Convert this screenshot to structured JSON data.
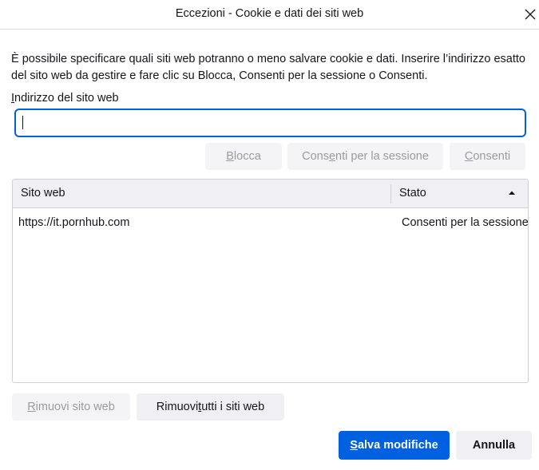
{
  "dialog": {
    "title": "Eccezioni - Cookie e dati dei siti web",
    "description": "È possibile specificare quali siti web potranno o meno salvare cookie e dati. Inserire l’indirizzo esatto del sito web da gestire e fare clic su Blocca, Consenti per la sessione o Consenti.",
    "close_icon": "close-icon"
  },
  "address": {
    "label_underlined": "I",
    "label_rest": "ndirizzo del sito web",
    "value": "",
    "placeholder": ""
  },
  "actions": {
    "block": {
      "pre": "",
      "ul": "B",
      "post": "locca"
    },
    "session": {
      "pre": "Cons",
      "ul": "e",
      "post": "nti per la sessione"
    },
    "allow": {
      "pre": "",
      "ul": "C",
      "post": "onsenti"
    }
  },
  "table": {
    "columns": [
      "Sito web",
      "Stato"
    ],
    "sort_icon": "sort-ascending-icon",
    "rows": [
      {
        "site": "https://it.pornhub.com",
        "status": "Consenti per la sessione"
      }
    ]
  },
  "list_actions": {
    "remove": {
      "pre": "",
      "ul": "R",
      "post": "imuovi sito web"
    },
    "remove_all": {
      "pre": "Rimuovi ",
      "ul": "t",
      "post": "utti i siti web"
    }
  },
  "footer": {
    "save": {
      "pre": "",
      "ul": "S",
      "post": "alva modifiche"
    },
    "cancel": "Annulla"
  },
  "colors": {
    "accent": "#0061e0",
    "button_bg": "#f0f0f4",
    "disabled_text": "#9a9aa0"
  }
}
